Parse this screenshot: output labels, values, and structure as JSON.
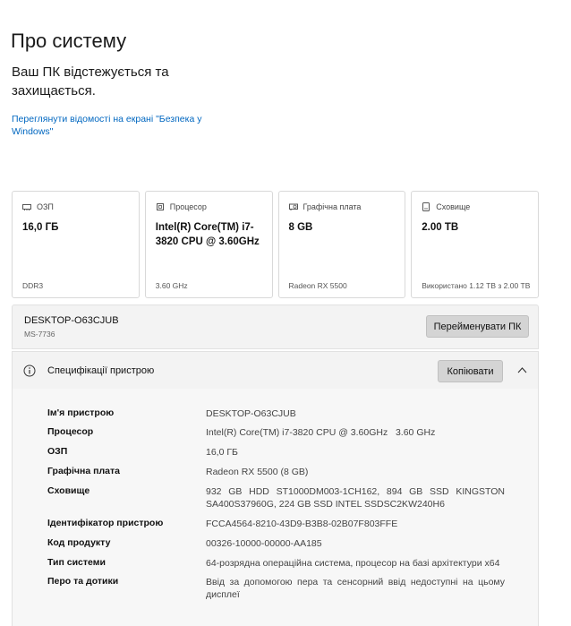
{
  "page": {
    "title": "Про систему",
    "status": "Ваш ПК відстежується та захищається.",
    "security_link": "Переглянути відомості на екрані \"Безпека у Windows\""
  },
  "cards": [
    {
      "icon": "memory-icon",
      "label": "ОЗП",
      "value": "16,0 ГБ",
      "footer": "DDR3"
    },
    {
      "icon": "processor-icon",
      "label": "Процесор",
      "value": "Intel(R) Core(TM) i7-3820 CPU @ 3.60GHz",
      "footer": "3.60 GHz"
    },
    {
      "icon": "graphics-card-icon",
      "label": "Графічна плата",
      "value": "8 GB",
      "footer": "Radeon RX 5500"
    },
    {
      "icon": "storage-icon",
      "label": "Сховище",
      "value": "2.00 TB",
      "footer": "Використано 1.12 TB з 2.00 TB"
    }
  ],
  "device": {
    "name": "DESKTOP-O63CJUB",
    "model": "MS-7736",
    "rename_label": "Перейменувати ПК"
  },
  "specs": {
    "title": "Специфікації пристрою",
    "copy_label": "Копіювати",
    "rows": [
      {
        "label": "Ім'я пристрою",
        "value": "DESKTOP-O63CJUB"
      },
      {
        "label": "Процесор",
        "value": "Intel(R) Core(TM) i7-3820 CPU @ 3.60GHz   3.60 GHz"
      },
      {
        "label": "ОЗП",
        "value": "16,0 ГБ"
      },
      {
        "label": "Графічна плата",
        "value": "Radeon RX 5500 (8 GB)"
      },
      {
        "label": "Сховище",
        "value": "932 GB HDD ST1000DM003-1CH162, 894 GB SSD KINGSTON SA400S37960G, 224 GB SSD INTEL SSDSC2KW240H6"
      },
      {
        "label": "Ідентифікатор пристрою",
        "value": "FCCA4564-8210-43D9-B3B8-02B07F803FFE"
      },
      {
        "label": "Код продукту",
        "value": "00326-10000-00000-AA185"
      },
      {
        "label": "Тип системи",
        "value": "64-розрядна операційна система, процесор на базі архітектури x64"
      },
      {
        "label": "Перо та дотики",
        "value": "Ввід за допомогою пера та сенсорний ввід недоступні на цьому дисплеї"
      }
    ]
  }
}
